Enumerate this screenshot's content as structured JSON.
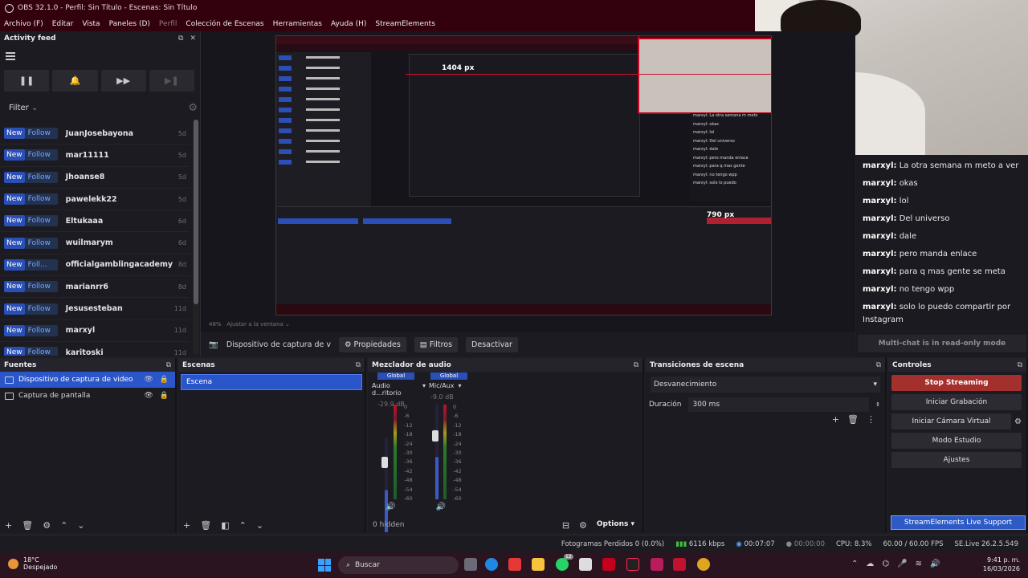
{
  "window": {
    "title": "OBS 32.1.0 - Perfil: Sin Título - Escenas: Sin Título"
  },
  "menu": [
    "Archivo (F)",
    "Editar",
    "Vista",
    "Paneles (D)",
    "Perfil",
    "Colección de Escenas",
    "Herramientas",
    "Ayuda (H)",
    "StreamElements"
  ],
  "activity": {
    "title": "Activity feed",
    "filter_label": "Filter",
    "items": [
      {
        "tag": "New",
        "type": "Follow",
        "user": "JuanJosebayona",
        "age": "5d"
      },
      {
        "tag": "New",
        "type": "Follow",
        "user": "mar11111",
        "age": "5d"
      },
      {
        "tag": "New",
        "type": "Follow",
        "user": "Jhoanse8",
        "age": "5d"
      },
      {
        "tag": "New",
        "type": "Follow",
        "user": "pawelekk22",
        "age": "5d"
      },
      {
        "tag": "New",
        "type": "Follow",
        "user": "Eltukaaa",
        "age": "6d"
      },
      {
        "tag": "New",
        "type": "Follow",
        "user": "wuilmarym",
        "age": "6d"
      },
      {
        "tag": "New",
        "type": "Foll...",
        "user": "officialgamblingacademy",
        "age": "8d"
      },
      {
        "tag": "New",
        "type": "Follow",
        "user": "marianrr6",
        "age": "8d"
      },
      {
        "tag": "New",
        "type": "Follow",
        "user": "Jesusesteban",
        "age": "11d"
      },
      {
        "tag": "New",
        "type": "Follow",
        "user": "marxyl",
        "age": "11d"
      },
      {
        "tag": "New",
        "type": "Follow",
        "user": "karitoski",
        "age": "11d"
      }
    ]
  },
  "preview": {
    "px_label_1": "1404 px",
    "px_label_2": "790 px",
    "zoom": "48%",
    "fit_label": "Ajustar a la ventana"
  },
  "chat": {
    "lines": [
      {
        "user": "marxyl:",
        "msg": "La otra semana m meto a ver"
      },
      {
        "user": "marxyl:",
        "msg": "okas"
      },
      {
        "user": "marxyl:",
        "msg": "lol"
      },
      {
        "user": "marxyl:",
        "msg": "Del universo"
      },
      {
        "user": "marxyl:",
        "msg": "dale"
      },
      {
        "user": "marxyl:",
        "msg": "pero manda enlace"
      },
      {
        "user": "marxyl:",
        "msg": "para q mas gente se meta"
      },
      {
        "user": "marxyl:",
        "msg": "no tengo wpp"
      },
      {
        "user": "marxyl:",
        "msg": "solo lo puedo compartir por Instagram"
      }
    ],
    "readonly": "Multi-chat is in read-only mode"
  },
  "context": {
    "source": "Dispositivo de captura de v",
    "props": "Propiedades",
    "filters": "Filtros",
    "deactivate": "Desactivar"
  },
  "fuentes": {
    "title": "Fuentes",
    "items": [
      "Dispositivo de captura de video",
      "Captura de pantalla"
    ]
  },
  "escenas": {
    "title": "Escenas",
    "items": [
      "Escena"
    ]
  },
  "mixer": {
    "title": "Mezclador de audio",
    "hidden": "0 hidden",
    "options": "Options",
    "channels": [
      {
        "global": "Global",
        "name": "Audio d...ritorio",
        "db": "-29.9 dB"
      },
      {
        "global": "Global",
        "name": "Mic/Aux",
        "db": "-9.0 dB"
      }
    ],
    "scale": [
      "0",
      "-6",
      "-12",
      "-18",
      "-24",
      "-30",
      "-36",
      "-42",
      "-48",
      "-54",
      "-60"
    ]
  },
  "transiciones": {
    "title": "Transiciones de escena",
    "type": "Desvanecimiento",
    "duration_label": "Duración",
    "duration": "300 ms"
  },
  "controles": {
    "title": "Controles",
    "stop": "Stop Streaming",
    "record": "Iniciar Grabación",
    "vcam": "Iniciar Cámara Virtual",
    "studio": "Modo Estudio",
    "settings": "Ajustes",
    "support": "StreamElements Live Support"
  },
  "status": {
    "dropped": "Fotogramas Perdidos 0 (0.0%)",
    "kbps": "6116 kbps",
    "live_time": "00:07:07",
    "rec_time": "00:00:00",
    "cpu": "CPU: 8.3%",
    "fps": "60.00 / 60.00 FPS",
    "se": "SE.Live 26.2.5.549"
  },
  "taskbar": {
    "temp": "18°C",
    "weather": "Despejado",
    "search": "Buscar",
    "time": "9:41 p. m.",
    "date": "16/03/2026",
    "badge": "12"
  }
}
